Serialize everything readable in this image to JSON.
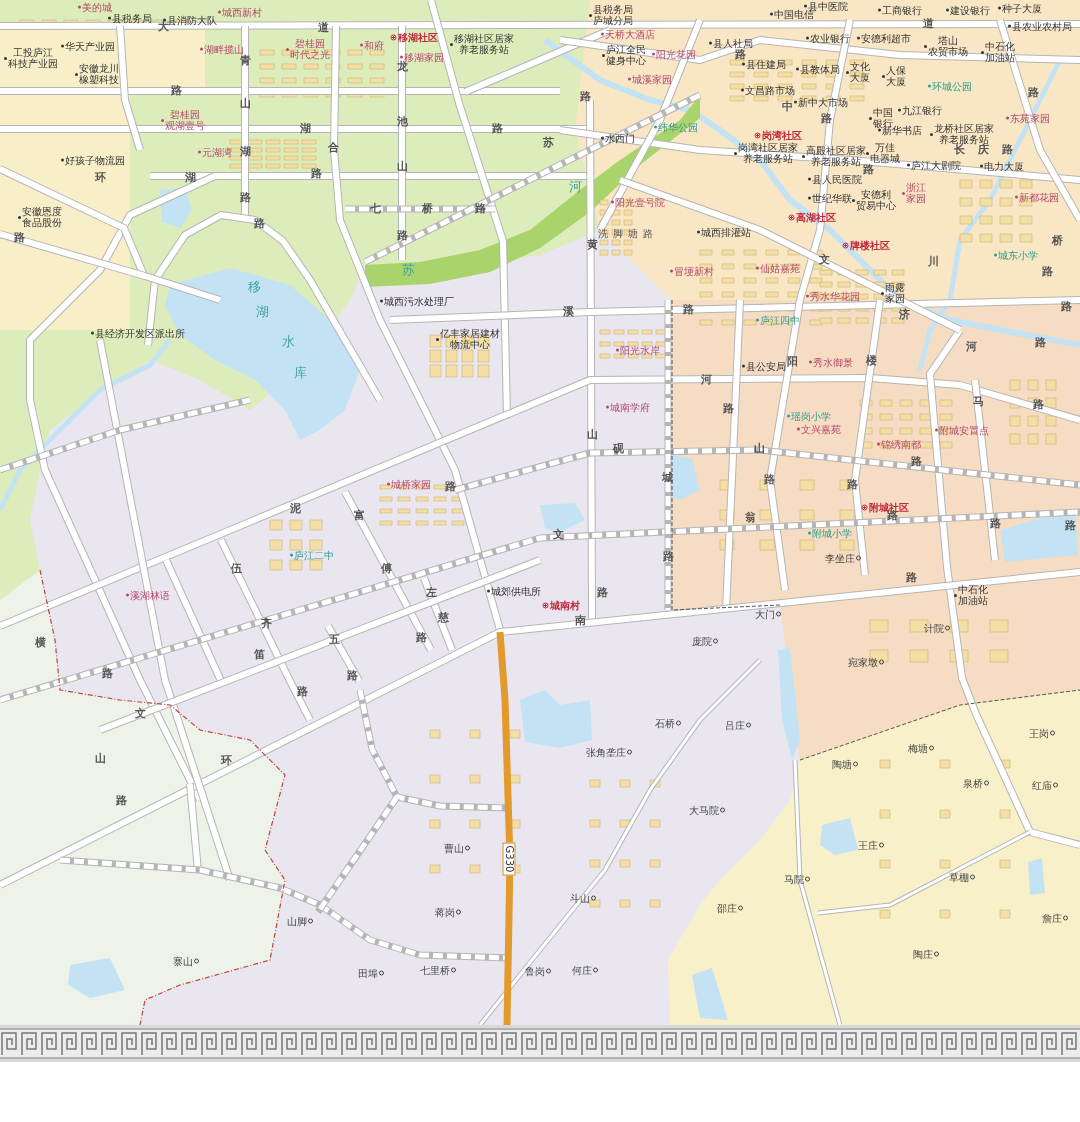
{
  "map": {
    "places": [
      {
        "kind": "institution",
        "text": "县税务局"
      },
      {
        "kind": "institution",
        "text": "县消防大队"
      },
      {
        "kind": "estate",
        "text": "美的城"
      },
      {
        "kind": "estate",
        "text": "城西新村"
      },
      {
        "kind": "institution",
        "text": "华天产业园"
      },
      {
        "kind": "institution",
        "lines": [
          "工投庐江",
          "科技产业园"
        ]
      },
      {
        "kind": "institution",
        "lines": [
          "安徽龙川",
          "橡塑科技"
        ]
      },
      {
        "kind": "estate",
        "text": "湖畔揽山"
      },
      {
        "kind": "estate",
        "lines": [
          "碧桂园",
          "时代之光"
        ]
      },
      {
        "kind": "estate",
        "text": "和府"
      },
      {
        "kind": "community",
        "text": "移湖社区"
      },
      {
        "kind": "institution",
        "lines": [
          "移湖社区居家",
          "养老服务站"
        ]
      },
      {
        "kind": "estate",
        "text": "移湖家园"
      },
      {
        "kind": "estate",
        "lines": [
          "碧桂园",
          "观湖壹号"
        ]
      },
      {
        "kind": "estate",
        "text": "元湖湾"
      },
      {
        "kind": "institution",
        "text": "好孩子物流园"
      },
      {
        "kind": "institution",
        "lines": [
          "安徽恩度",
          "食品股份"
        ]
      },
      {
        "kind": "institution",
        "text": "县经济开发区派出所"
      },
      {
        "kind": "institution",
        "text": "城西污水处理厂"
      },
      {
        "kind": "institution",
        "lines": [
          "亿丰家居建材",
          "物流中心"
        ]
      },
      {
        "kind": "institution",
        "lines": [
          "县税务局",
          "庐城分局"
        ]
      },
      {
        "kind": "estate",
        "text": "天桥大酒店"
      },
      {
        "kind": "institution",
        "lines": [
          "庐江全民",
          "健身中心"
        ]
      },
      {
        "kind": "estate",
        "text": "阳光花园"
      },
      {
        "kind": "estate",
        "text": "城溪家园"
      },
      {
        "kind": "institution",
        "text": "县人社局"
      },
      {
        "kind": "institution",
        "text": "县住建局"
      },
      {
        "kind": "institution",
        "text": "农业银行"
      },
      {
        "kind": "institution",
        "text": "县教体局"
      },
      {
        "kind": "institution",
        "text": "安德利超市"
      },
      {
        "kind": "institution",
        "lines": [
          "塔山",
          "农贸市场"
        ]
      },
      {
        "kind": "institution",
        "lines": [
          "中石化",
          "加油站"
        ]
      },
      {
        "kind": "institution",
        "text": "县农业农村局"
      },
      {
        "kind": "institution",
        "text": "中国电信"
      },
      {
        "kind": "institution",
        "text": "县中医院"
      },
      {
        "kind": "institution",
        "text": "工商银行"
      },
      {
        "kind": "institution",
        "text": "建设银行"
      },
      {
        "kind": "institution",
        "text": "种子大厦"
      },
      {
        "kind": "institution",
        "lines": [
          "文化",
          "大厦"
        ]
      },
      {
        "kind": "institution",
        "lines": [
          "人保",
          "大厦"
        ]
      },
      {
        "kind": "institution",
        "text": "文昌路市场"
      },
      {
        "kind": "green",
        "text": "环城公园"
      },
      {
        "kind": "institution",
        "text": "新中大市场"
      },
      {
        "kind": "institution",
        "lines": [
          "中国",
          "银行"
        ]
      },
      {
        "kind": "institution",
        "text": "九江银行"
      },
      {
        "kind": "community",
        "text": "岗湾社区"
      },
      {
        "kind": "institution",
        "text": "新华书店"
      },
      {
        "kind": "institution",
        "lines": [
          "龙桥社区居家",
          "养老服务站"
        ]
      },
      {
        "kind": "institution",
        "lines": [
          "岗湾社区居家",
          "养老服务站"
        ]
      },
      {
        "kind": "institution",
        "lines": [
          "高殿社区居家",
          "养老服务站"
        ]
      },
      {
        "kind": "institution",
        "lines": [
          "万佳",
          "电器城"
        ]
      },
      {
        "kind": "institution",
        "text": "庐江大剧院"
      },
      {
        "kind": "institution",
        "text": "电力大厦"
      },
      {
        "kind": "estate",
        "text": "东苑家园"
      },
      {
        "kind": "institution",
        "text": "县人民医院"
      },
      {
        "kind": "institution",
        "text": "世纪华联"
      },
      {
        "kind": "institution",
        "lines": [
          "安德利",
          "贸易中心"
        ]
      },
      {
        "kind": "estate",
        "lines": [
          "浙江",
          "家园"
        ]
      },
      {
        "kind": "community",
        "text": "高湖社区"
      },
      {
        "kind": "community",
        "text": "牌楼社区"
      },
      {
        "kind": "institution",
        "text": "城西排灌站"
      },
      {
        "kind": "estate",
        "text": "阳光壹号院"
      },
      {
        "kind": "street",
        "text": "洗脚塘路"
      },
      {
        "kind": "estate",
        "text": "冒埂新村"
      },
      {
        "kind": "estate",
        "text": "仙姑嘉苑"
      },
      {
        "kind": "estate",
        "text": "秀水华花园"
      },
      {
        "kind": "green",
        "text": "庐江四中"
      },
      {
        "kind": "institution",
        "lines": [
          "雨露",
          "家园"
        ]
      },
      {
        "kind": "estate",
        "text": "新都花园"
      },
      {
        "kind": "green",
        "text": "城东小学"
      },
      {
        "kind": "green",
        "text": "纬华公园"
      },
      {
        "kind": "institution",
        "text": "水西门"
      },
      {
        "kind": "estate",
        "text": "阳光水岸"
      },
      {
        "kind": "institution",
        "text": "县公安局"
      },
      {
        "kind": "estate",
        "text": "秀水御景"
      },
      {
        "kind": "estate",
        "text": "城南学府"
      },
      {
        "kind": "green",
        "text": "瑶岗小学"
      },
      {
        "kind": "estate",
        "text": "文兴嘉苑"
      },
      {
        "kind": "estate",
        "text": "锦绣南都"
      },
      {
        "kind": "estate",
        "text": "附城安置点"
      },
      {
        "kind": "community",
        "text": "附城社区"
      },
      {
        "kind": "green",
        "text": "附城小学"
      },
      {
        "kind": "village",
        "text": "李坐庄"
      },
      {
        "kind": "community",
        "text": "城南村"
      },
      {
        "kind": "institution",
        "lines": [
          "中石化",
          "加油站"
        ]
      },
      {
        "kind": "village",
        "text": "大门"
      },
      {
        "kind": "village",
        "text": "庞院"
      },
      {
        "kind": "village",
        "text": "计院"
      },
      {
        "kind": "village",
        "text": "宛家墩"
      },
      {
        "kind": "estate",
        "text": "溪湖林语"
      },
      {
        "kind": "green",
        "text": "庐江二中"
      },
      {
        "kind": "estate",
        "text": "城桥家园"
      },
      {
        "kind": "institution",
        "text": "城郊供电所"
      },
      {
        "kind": "village",
        "text": "曹山"
      },
      {
        "kind": "village",
        "text": "蒋岗"
      },
      {
        "kind": "village",
        "text": "山脚"
      },
      {
        "kind": "village",
        "text": "寨山"
      },
      {
        "kind": "village",
        "text": "田埠"
      },
      {
        "kind": "village",
        "text": "七里桥"
      },
      {
        "kind": "village",
        "text": "鲁岗"
      },
      {
        "kind": "village",
        "text": "石桥"
      },
      {
        "kind": "village",
        "text": "吕庄"
      },
      {
        "kind": "village",
        "text": "张角垄庄"
      },
      {
        "kind": "village",
        "text": "大马院"
      },
      {
        "kind": "village",
        "text": "斗山"
      },
      {
        "kind": "village",
        "text": "何庄"
      },
      {
        "kind": "village",
        "text": "邵庄"
      },
      {
        "kind": "village",
        "text": "马院"
      },
      {
        "kind": "village",
        "text": "陶塘"
      },
      {
        "kind": "village",
        "text": "梅塘"
      },
      {
        "kind": "village",
        "text": "王岗"
      },
      {
        "kind": "village",
        "text": "泉桥"
      },
      {
        "kind": "village",
        "text": "红庙"
      },
      {
        "kind": "village",
        "text": "王庄"
      },
      {
        "kind": "village",
        "text": "草棚"
      },
      {
        "kind": "village",
        "text": "陶庄"
      },
      {
        "kind": "village",
        "text": "詹庄"
      }
    ],
    "road_labels": [
      {
        "kind": "road",
        "text": "大"
      },
      {
        "kind": "road",
        "text": "道"
      },
      {
        "kind": "road",
        "text": "青"
      },
      {
        "kind": "road",
        "text": "路"
      },
      {
        "kind": "road",
        "text": "山"
      },
      {
        "kind": "road",
        "text": "湖"
      },
      {
        "kind": "road",
        "text": "路"
      },
      {
        "kind": "road",
        "text": "湖"
      },
      {
        "kind": "road",
        "text": "合"
      },
      {
        "kind": "road",
        "text": "路"
      },
      {
        "kind": "road",
        "text": "路"
      },
      {
        "kind": "road",
        "text": "环"
      },
      {
        "kind": "road",
        "text": "湖"
      },
      {
        "kind": "road",
        "text": "龙"
      },
      {
        "kind": "road",
        "text": "池"
      },
      {
        "kind": "road",
        "text": "山"
      },
      {
        "kind": "road",
        "text": "路"
      },
      {
        "kind": "road",
        "text": "七"
      },
      {
        "kind": "road",
        "text": "桥"
      },
      {
        "kind": "road",
        "text": "路"
      },
      {
        "kind": "road",
        "text": "苏"
      },
      {
        "kind": "road",
        "text": "路"
      },
      {
        "kind": "road",
        "text": "路"
      },
      {
        "kind": "road",
        "text": "路"
      },
      {
        "kind": "water",
        "text": "移"
      },
      {
        "kind": "water",
        "text": "湖"
      },
      {
        "kind": "water",
        "text": "水"
      },
      {
        "kind": "water",
        "text": "库"
      },
      {
        "kind": "water",
        "text": "苏"
      },
      {
        "kind": "water",
        "text": "河"
      },
      {
        "kind": "road",
        "text": "泥"
      },
      {
        "kind": "road",
        "text": "路"
      },
      {
        "kind": "road",
        "text": "富"
      },
      {
        "kind": "road",
        "text": "傅"
      },
      {
        "kind": "road",
        "text": "左"
      },
      {
        "kind": "road",
        "text": "慈"
      },
      {
        "kind": "road",
        "text": "路"
      },
      {
        "kind": "road",
        "text": "伍"
      },
      {
        "kind": "road",
        "text": "齐"
      },
      {
        "kind": "road",
        "text": "笛"
      },
      {
        "kind": "road",
        "text": "五"
      },
      {
        "kind": "road",
        "text": "路"
      },
      {
        "kind": "road",
        "text": "横"
      },
      {
        "kind": "road",
        "text": "路"
      },
      {
        "kind": "road",
        "text": "文"
      },
      {
        "kind": "road",
        "text": "山"
      },
      {
        "kind": "road",
        "text": "环"
      },
      {
        "kind": "road",
        "text": "路"
      },
      {
        "kind": "road",
        "text": "路"
      },
      {
        "kind": "road",
        "text": "河"
      },
      {
        "kind": "road",
        "text": "路"
      },
      {
        "kind": "road",
        "text": "砚"
      },
      {
        "kind": "road",
        "text": "山"
      },
      {
        "kind": "road",
        "text": "山"
      },
      {
        "kind": "road",
        "text": "路"
      },
      {
        "kind": "road",
        "text": "路"
      },
      {
        "kind": "road",
        "text": "路"
      },
      {
        "kind": "road",
        "text": "城"
      },
      {
        "kind": "road",
        "text": "翁"
      },
      {
        "kind": "road",
        "text": "路"
      },
      {
        "kind": "road",
        "text": "文"
      },
      {
        "kind": "road",
        "text": "路"
      },
      {
        "kind": "road",
        "text": "路"
      },
      {
        "kind": "road",
        "text": "南"
      },
      {
        "kind": "road",
        "text": "路"
      },
      {
        "kind": "road",
        "text": "马"
      },
      {
        "kind": "road",
        "text": "路"
      },
      {
        "kind": "road",
        "text": "路"
      },
      {
        "kind": "road",
        "text": "路"
      },
      {
        "kind": "road",
        "text": "阳"
      },
      {
        "kind": "road",
        "text": "楼"
      },
      {
        "kind": "road",
        "text": "河"
      },
      {
        "kind": "road",
        "text": "路"
      },
      {
        "kind": "road",
        "text": "黄"
      },
      {
        "kind": "road",
        "text": "溪"
      },
      {
        "kind": "road",
        "text": "路"
      },
      {
        "kind": "road",
        "text": "文"
      },
      {
        "kind": "road",
        "text": "济"
      },
      {
        "kind": "road",
        "text": "长"
      },
      {
        "kind": "road",
        "text": "庆"
      },
      {
        "kind": "road",
        "text": "路"
      },
      {
        "kind": "road",
        "text": "川"
      },
      {
        "kind": "road",
        "text": "路"
      },
      {
        "kind": "road",
        "text": "路"
      },
      {
        "kind": "road",
        "text": "路"
      },
      {
        "kind": "road",
        "text": "桥"
      },
      {
        "kind": "road",
        "text": "道"
      },
      {
        "kind": "road",
        "text": "路"
      },
      {
        "kind": "road",
        "text": "中"
      },
      {
        "kind": "road",
        "text": "路"
      },
      {
        "kind": "road",
        "text": "路"
      }
    ],
    "route_shield": "G330"
  }
}
